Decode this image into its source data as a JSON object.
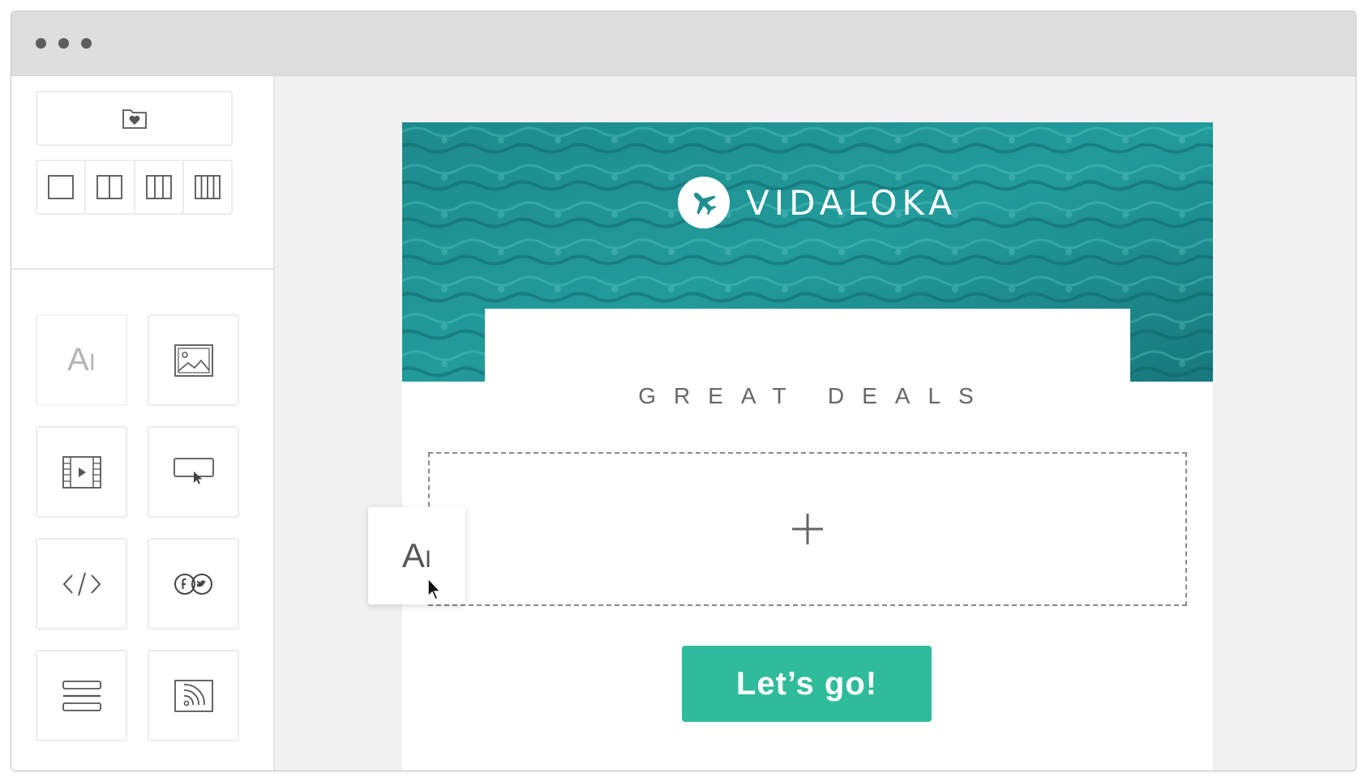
{
  "window": {
    "controls": [
      "window-dot",
      "window-dot",
      "window-dot"
    ]
  },
  "sidebar": {
    "top_tool": {
      "icon": "folder-heart-icon"
    },
    "layouts": [
      {
        "icon": "one-column-icon"
      },
      {
        "icon": "two-column-icon"
      },
      {
        "icon": "three-column-icon"
      },
      {
        "icon": "four-column-icon"
      }
    ],
    "blocks": [
      {
        "icon": "text-block-icon",
        "glyph": "A"
      },
      {
        "icon": "image-block-icon"
      },
      {
        "icon": "video-block-icon"
      },
      {
        "icon": "button-block-icon"
      },
      {
        "icon": "code-block-icon"
      },
      {
        "icon": "social-block-icon"
      },
      {
        "icon": "divider-block-icon"
      },
      {
        "icon": "rss-block-icon"
      }
    ]
  },
  "email": {
    "brand_name": "VIDALOKA",
    "brand_icon": "airplane-icon",
    "headline": "GREAT DEALS",
    "dropzone_icon": "plus-icon",
    "cta_label": "Let’s go!",
    "colors": {
      "hero": "#1f8f8f",
      "cta": "#2fbc9b",
      "headline": "#666666"
    }
  },
  "drag": {
    "glyph": "A",
    "icon": "text-block-icon",
    "cursor": "cursor-arrow-icon"
  }
}
